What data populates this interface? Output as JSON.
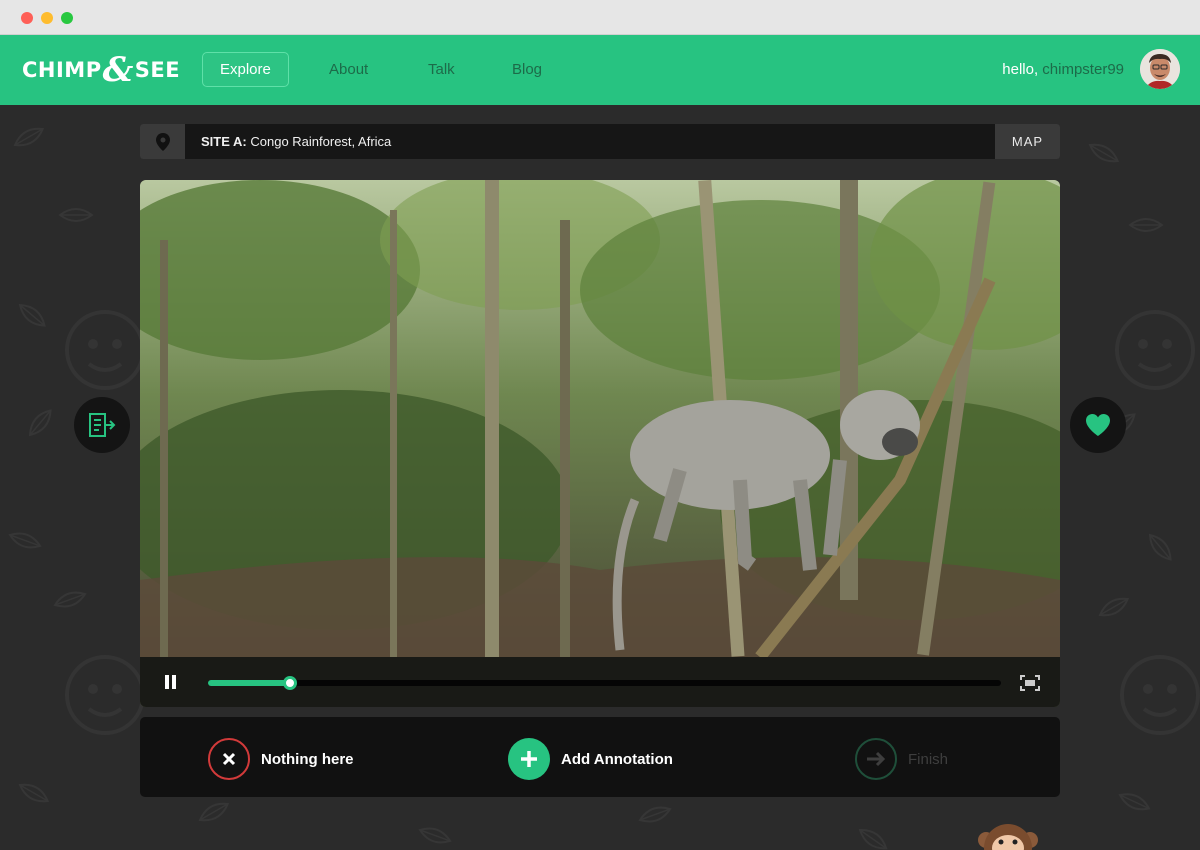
{
  "window": {
    "controls": [
      "close",
      "minimize",
      "maximize"
    ]
  },
  "nav": {
    "logo_part1": "CHIMP",
    "logo_amp": "&",
    "logo_part2": "SEE",
    "links": [
      {
        "label": "Explore",
        "active": true
      },
      {
        "label": "About",
        "active": false
      },
      {
        "label": "Talk",
        "active": false
      },
      {
        "label": "Blog",
        "active": false
      }
    ],
    "greeting": "hello,",
    "username": "chimpster99"
  },
  "site": {
    "code": "SITE A:",
    "location": "Congo Rainforest, Africa",
    "map_label": "MAP"
  },
  "video": {
    "state": "playing",
    "progress": 0.103
  },
  "actions": {
    "nothing_label": "Nothing here",
    "add_label": "Add Annotation",
    "finish_label": "Finish"
  },
  "colors": {
    "brand_green": "#27c381",
    "dark_green_text": "#1d6b49",
    "page_bg": "#2b2b2b",
    "danger": "#d23a3a"
  },
  "icons": {
    "pin": "map-pin-icon",
    "guide": "field-guide-icon",
    "favorite": "heart-icon",
    "pause": "pause-icon",
    "fullscreen": "fullscreen-icon",
    "close": "close-icon",
    "plus": "plus-icon",
    "arrow": "arrow-right-icon"
  }
}
